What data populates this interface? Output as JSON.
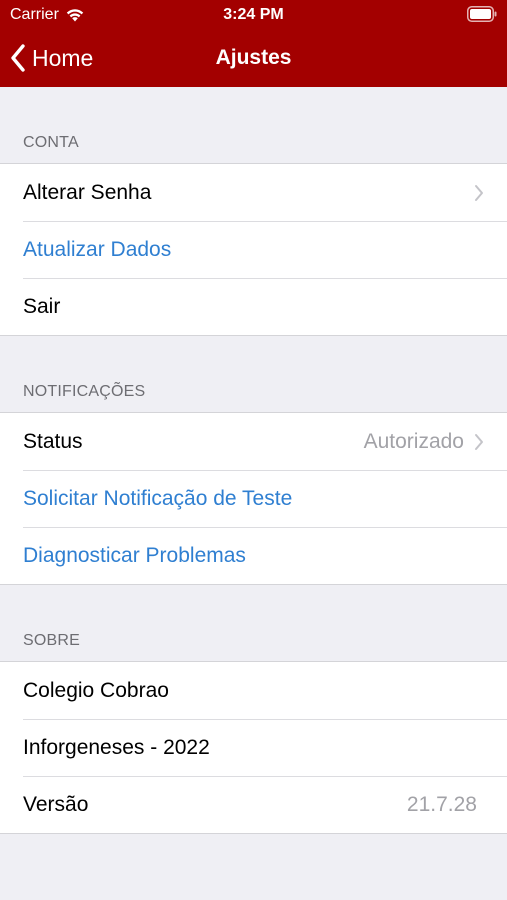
{
  "status_bar": {
    "carrier": "Carrier",
    "time": "3:24 PM"
  },
  "nav": {
    "back_label": "Home",
    "title": "Ajustes"
  },
  "sections": {
    "conta": {
      "header": "CONTA",
      "items": [
        {
          "label": "Alterar Senha",
          "style": "default",
          "chevron": true
        },
        {
          "label": "Atualizar Dados",
          "style": "link"
        },
        {
          "label": "Sair",
          "style": "default"
        }
      ]
    },
    "notificacoes": {
      "header": "NOTIFICAÇÕES",
      "items": [
        {
          "label": "Status",
          "detail": "Autorizado",
          "chevron": true
        },
        {
          "label": "Solicitar Notificação de Teste",
          "style": "link"
        },
        {
          "label": "Diagnosticar Problemas",
          "style": "link"
        }
      ]
    },
    "sobre": {
      "header": "SOBRE",
      "items": [
        {
          "label": "Colegio Cobrao"
        },
        {
          "label": "Inforgeneses - 2022"
        },
        {
          "label": "Versão",
          "detail": "21.7.28"
        }
      ]
    }
  },
  "colors": {
    "nav_background": "#a30000",
    "link": "#2f7fd1",
    "background": "#efeff4",
    "detail_text": "#a2a2a7",
    "section_header_text": "#6d6d72"
  }
}
